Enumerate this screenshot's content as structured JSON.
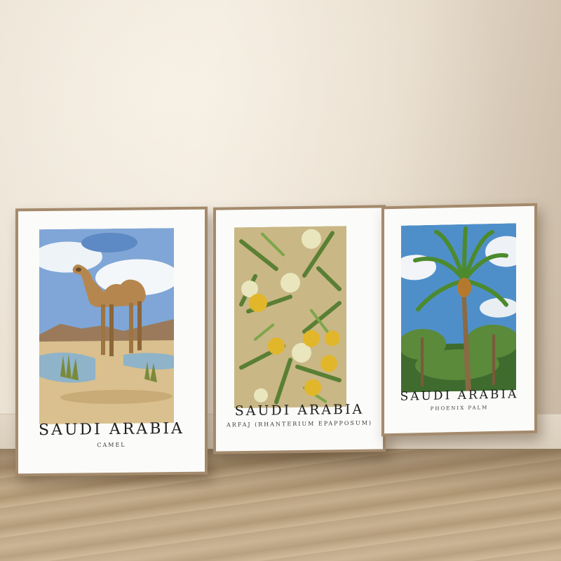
{
  "posters": [
    {
      "title": "SAUDI ARABIA",
      "subtitle": "CAMEL",
      "artwork_icon": "camel-illustration"
    },
    {
      "title": "SAUDI ARABIA",
      "subtitle": "ARFAJ (RHANTERIUM EPAPPOSUM)",
      "artwork_icon": "arfaj-flower-illustration"
    },
    {
      "title": "SAUDI ARABIA",
      "subtitle": "PHOENIX PALM",
      "artwork_icon": "palm-tree-illustration"
    }
  ],
  "colors": {
    "wall": "#ece3d5",
    "floor": "#bfa786",
    "frame": "#a48a6c",
    "mat": "#fbfbf9"
  }
}
